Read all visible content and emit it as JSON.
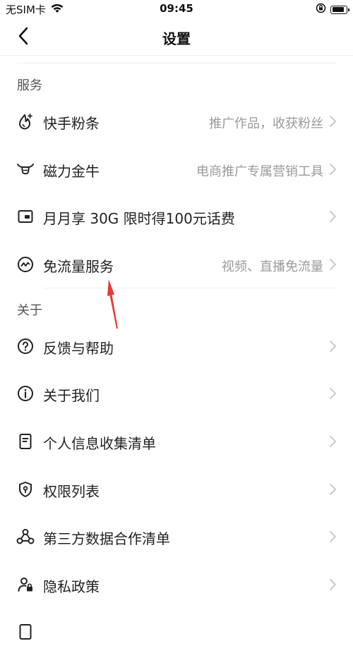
{
  "status_bar": {
    "carrier": "无SIM卡",
    "time": "09:45",
    "battery_level": 0.9
  },
  "nav": {
    "title": "设置"
  },
  "sections": [
    {
      "header": "服务",
      "items": [
        {
          "label": "快手粉条",
          "subtitle": "推广作品，收获粉丝",
          "icon": "fire-drop-icon"
        },
        {
          "label": "磁力金牛",
          "subtitle": "电商推广专属营销工具",
          "icon": "bull-icon"
        },
        {
          "label": "月月享 30G 限时得100元话费",
          "subtitle": "",
          "icon": "sim-card-icon"
        },
        {
          "label": "免流量服务",
          "subtitle": "视频、直播免流量",
          "icon": "data-wave-icon"
        }
      ]
    },
    {
      "header": "关于",
      "items": [
        {
          "label": "反馈与帮助",
          "subtitle": "",
          "icon": "question-icon"
        },
        {
          "label": "关于我们",
          "subtitle": "",
          "icon": "info-icon"
        },
        {
          "label": "个人信息收集清单",
          "subtitle": "",
          "icon": "document-icon"
        },
        {
          "label": "权限列表",
          "subtitle": "",
          "icon": "shield-key-icon"
        },
        {
          "label": "第三方数据合作清单",
          "subtitle": "",
          "icon": "network-icon"
        },
        {
          "label": "隐私政策",
          "subtitle": "",
          "icon": "user-lock-icon"
        }
      ]
    }
  ],
  "colors": {
    "annotation_arrow": "#e53935"
  }
}
